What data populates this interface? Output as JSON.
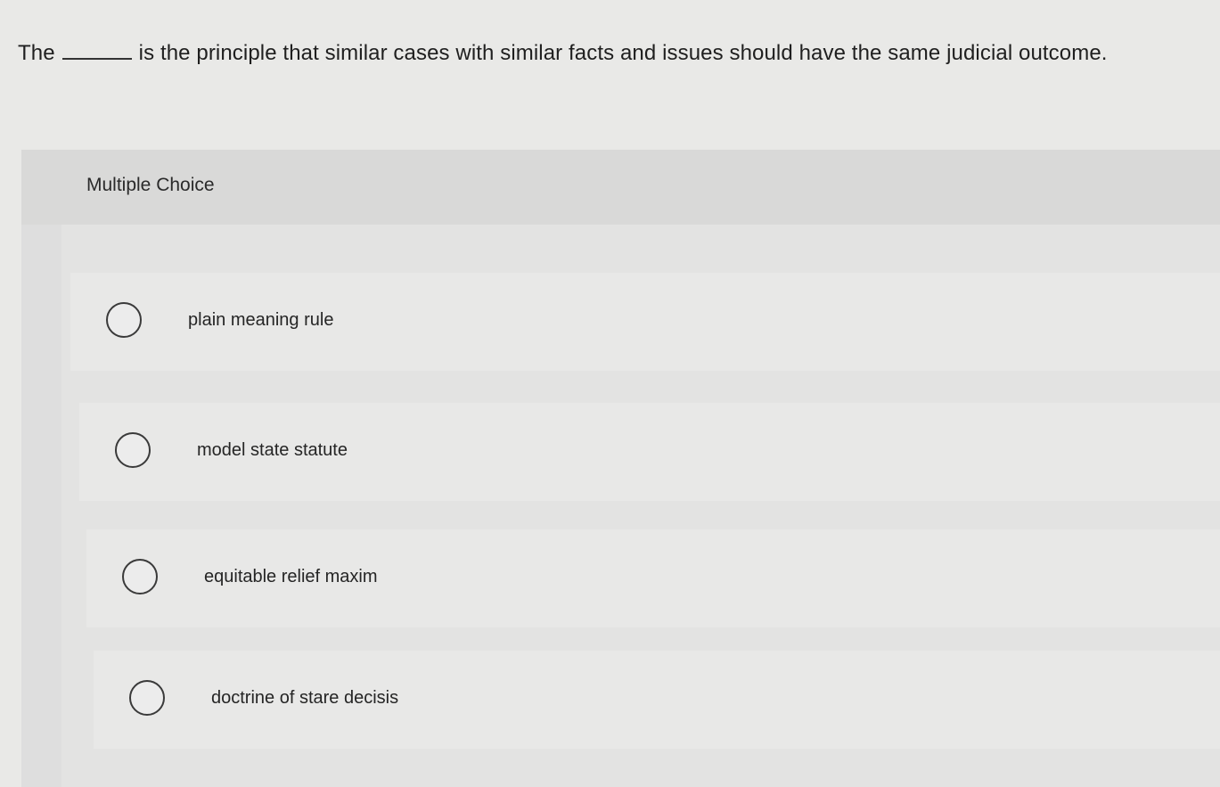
{
  "question": {
    "before_blank": "The",
    "after_blank": "is the principle that similar cases with similar facts and issues should have the same judicial outcome."
  },
  "panel": {
    "title": "Multiple Choice"
  },
  "options": [
    {
      "label": "plain meaning rule"
    },
    {
      "label": "model state statute"
    },
    {
      "label": "equitable relief maxim"
    },
    {
      "label": "doctrine of stare decisis"
    }
  ]
}
